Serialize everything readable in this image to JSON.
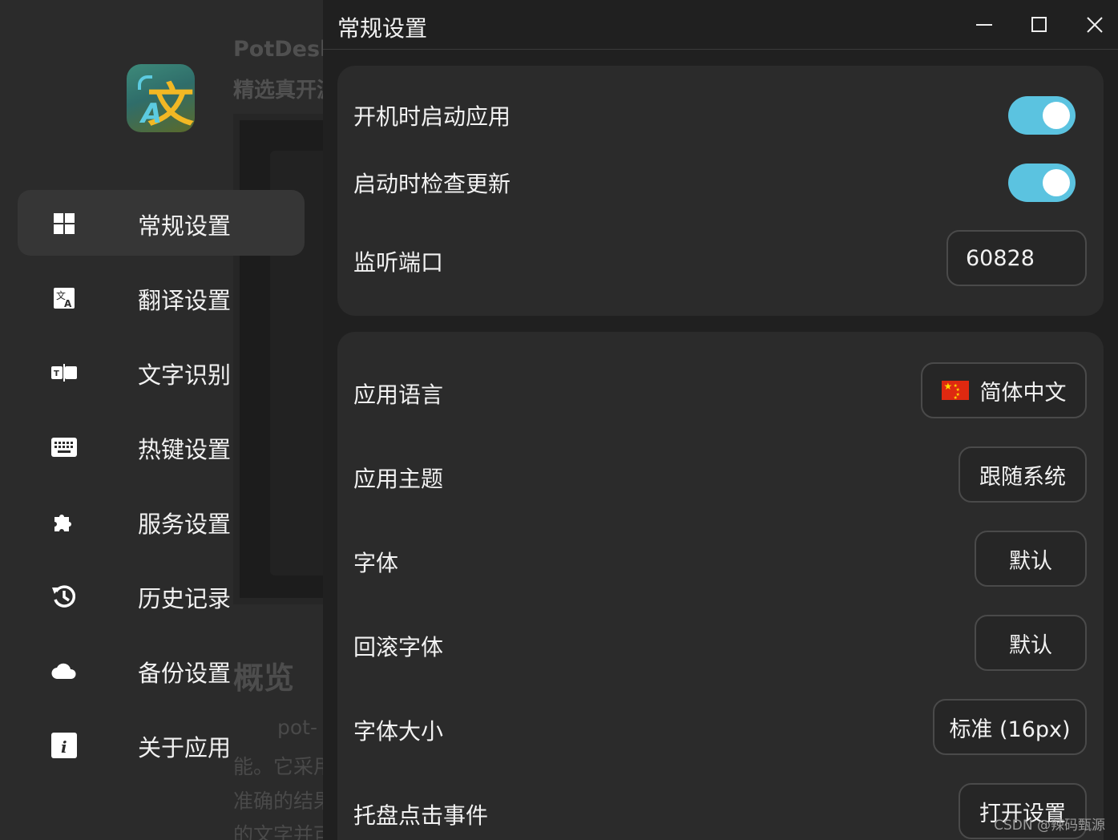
{
  "window": {
    "title": "常规设置",
    "controls": [
      "minimize",
      "maximize",
      "close"
    ]
  },
  "background": {
    "title": "PotDesk",
    "subtitle": "精选真开源",
    "heading": "概览",
    "lines": [
      "pot-",
      "能。它采用",
      "准确的结果",
      "的文字并可"
    ]
  },
  "app": {
    "logo_main": "文",
    "logo_small": "A"
  },
  "sidebar": {
    "items": [
      {
        "label": "常规设置",
        "icon": "grid-icon",
        "active": true
      },
      {
        "label": "翻译设置",
        "icon": "translate-icon",
        "active": false
      },
      {
        "label": "文字识别",
        "icon": "ocr-icon",
        "active": false
      },
      {
        "label": "热键设置",
        "icon": "keyboard-icon",
        "active": false
      },
      {
        "label": "服务设置",
        "icon": "puzzle-icon",
        "active": false
      },
      {
        "label": "历史记录",
        "icon": "history-icon",
        "active": false
      },
      {
        "label": "备份设置",
        "icon": "cloud-icon",
        "active": false
      },
      {
        "label": "关于应用",
        "icon": "info-icon",
        "active": false
      }
    ]
  },
  "settings": {
    "startup": {
      "label": "开机时启动应用",
      "enabled": true
    },
    "check_update": {
      "label": "启动时检查更新",
      "enabled": true
    },
    "port": {
      "label": "监听端口",
      "value": "60828"
    },
    "language": {
      "label": "应用语言",
      "value": "简体中文",
      "flag": "cn-flag-icon"
    },
    "theme": {
      "label": "应用主题",
      "value": "跟随系统"
    },
    "font": {
      "label": "字体",
      "value": "默认"
    },
    "fallback_font": {
      "label": "回滚字体",
      "value": "默认"
    },
    "font_size": {
      "label": "字体大小",
      "value": "标准 (16px)"
    },
    "tray_click": {
      "label": "托盘点击事件",
      "value": "打开设置"
    }
  },
  "watermark": "CSDN @辣码甄源",
  "colors": {
    "accent": "#5bc3e0",
    "card": "#2b2b2b",
    "background": "#202020"
  }
}
